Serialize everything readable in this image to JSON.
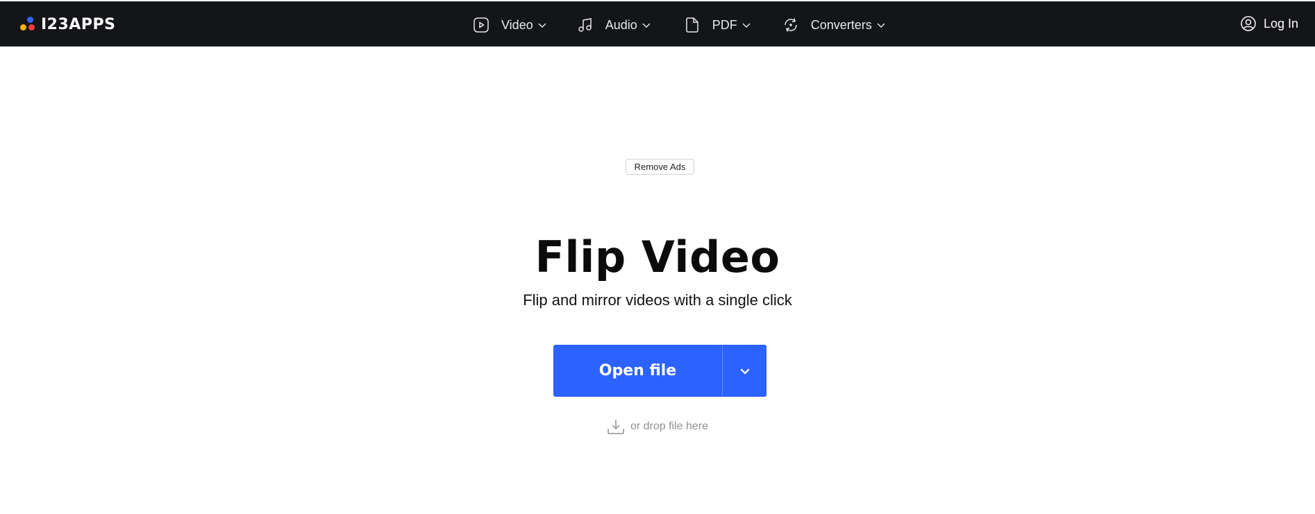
{
  "header": {
    "logo_text": "I23APPS",
    "logo_colors": [
      "#2f66ff",
      "#ffb300",
      "#ff3b3b"
    ],
    "nav": [
      {
        "label": "Video",
        "icon": "play-square-icon"
      },
      {
        "label": "Audio",
        "icon": "music-note-icon"
      },
      {
        "label": "PDF",
        "icon": "document-icon"
      },
      {
        "label": "Converters",
        "icon": "convert-arrows-icon"
      }
    ],
    "login_label": "Log In",
    "background": "#141518"
  },
  "ads": {
    "remove_label": "Remove Ads"
  },
  "main": {
    "title": "Flip Video",
    "subtitle": "Flip and mirror videos with a single click",
    "open_file_label": "Open file",
    "drop_hint": "or drop file here",
    "accent": "#2c62ff"
  }
}
